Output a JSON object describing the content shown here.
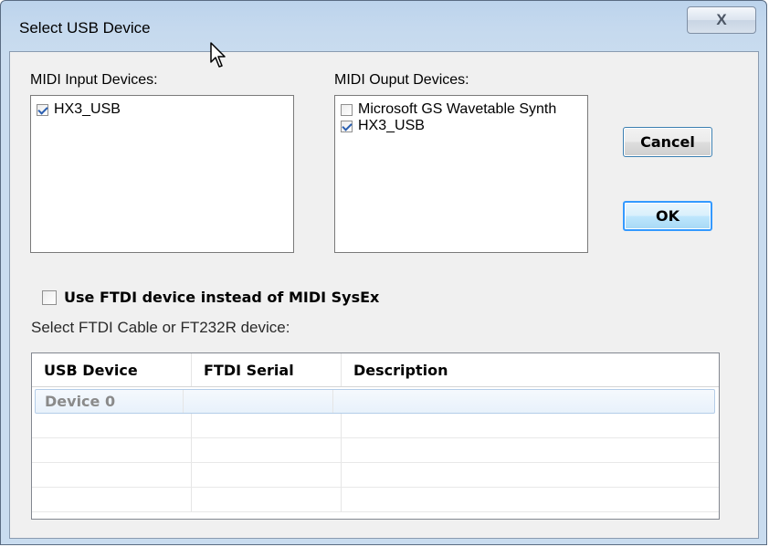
{
  "window": {
    "title": "Select USB Device",
    "close_label": "X"
  },
  "midi_input": {
    "label": "MIDI Input Devices:",
    "items": [
      {
        "label": "HX3_USB",
        "checked": true
      }
    ]
  },
  "midi_output": {
    "label": "MIDI Ouput Devices:",
    "items": [
      {
        "label": "Microsoft GS Wavetable Synth",
        "checked": false
      },
      {
        "label": "HX3_USB",
        "checked": true
      }
    ]
  },
  "buttons": {
    "cancel_label": "Cancel",
    "ok_label": "OK"
  },
  "ftdi": {
    "checkbox_label": "Use FTDI device instead of MIDI SysEx",
    "checked": false,
    "select_label": "Select FTDI Cable or  FT232R device:"
  },
  "device_table": {
    "columns": [
      "USB Device",
      "FTDI Serial",
      "Description"
    ],
    "rows": [
      [
        "Device 0",
        "",
        ""
      ],
      [
        "",
        "",
        ""
      ],
      [
        "",
        "",
        ""
      ],
      [
        "",
        "",
        ""
      ],
      [
        "",
        "",
        ""
      ]
    ],
    "selected_row": 0
  },
  "icons": {
    "cursor": "mouse-pointer-icon",
    "close": "close-icon"
  }
}
